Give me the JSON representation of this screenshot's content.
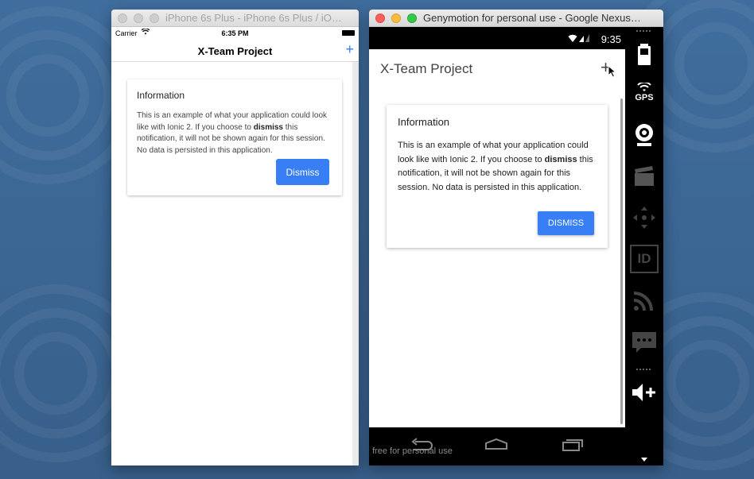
{
  "ios_window": {
    "title": "iPhone 6s Plus - iPhone 6s Plus / iO…",
    "status": {
      "carrier": "Carrier",
      "time": "6:35 PM"
    },
    "navbar": {
      "title": "X-Team Project",
      "plus": "+"
    },
    "card": {
      "title": "Information",
      "body_before": "This is an example of what your application could look like with Ionic 2. If you choose to ",
      "body_bold": "dismiss",
      "body_after": " this notification, it will not be shown again for this session. No data is persisted in this application.",
      "dismiss_label": "Dismiss"
    }
  },
  "genymotion_window": {
    "title": "Genymotion for personal use - Google Nexus…",
    "status": {
      "time": "9:35"
    },
    "toolbar": {
      "title": "X-Team Project",
      "plus": "+"
    },
    "card": {
      "title": "Information",
      "body_before": "This is an example of what your application could look like with Ionic 2. If you choose to ",
      "body_bold": "dismiss",
      "body_after": " this notification, it will not be shown again for this session.  No data is persisted in this application.",
      "dismiss_label": "DISMISS"
    },
    "watermark": "free for personal use",
    "sidebar": {
      "gps_label": "GPS",
      "id_label": "ID",
      "tools": [
        "battery-icon",
        "gps-icon",
        "camera-icon",
        "media-icon",
        "dpad-icon",
        "id-icon",
        "rss-icon",
        "sms-icon",
        "volume-up-icon",
        "scroll-down-icon"
      ]
    },
    "accent_color": "#387ef5"
  }
}
